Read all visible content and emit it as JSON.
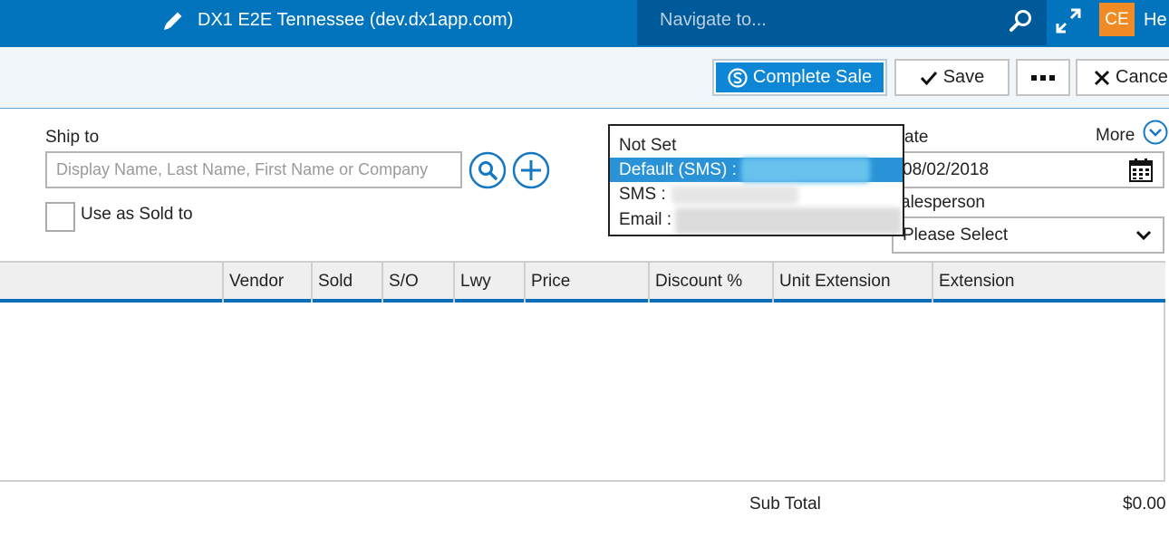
{
  "header": {
    "app_title": "DX1 E2E Tennessee (dev.dx1app.com)",
    "nav_placeholder": "Navigate to...",
    "avatar_initials": "CE",
    "user_name": "He",
    "brand_color": "#0174bd"
  },
  "toolbar": {
    "complete_sale_label": "Complete Sale",
    "save_label": "Save",
    "more_label": "...",
    "cancel_label": "Cance"
  },
  "form": {
    "ship_to_label": "Ship to",
    "ship_to_placeholder": "Display Name, Last Name, First Name or Company",
    "use_as_sold_to_label": "Use as Sold to",
    "date_label": "ate",
    "date_value": "08/02/2018",
    "salesperson_label": "alesperson",
    "salesperson_value": "Please Select",
    "more_label": "More"
  },
  "popup": {
    "items": [
      {
        "label": "Not Set"
      },
      {
        "label": "Default (SMS) :"
      },
      {
        "label": "SMS :"
      },
      {
        "label": "Email :"
      }
    ]
  },
  "table": {
    "columns": [
      "",
      "Vendor",
      "Sold",
      "S/O",
      "Lwy",
      "Price",
      "Discount %",
      "Unit Extension",
      "Extension"
    ]
  },
  "footer": {
    "subtotal_label": "Sub Total",
    "subtotal_value": "$0.00"
  }
}
